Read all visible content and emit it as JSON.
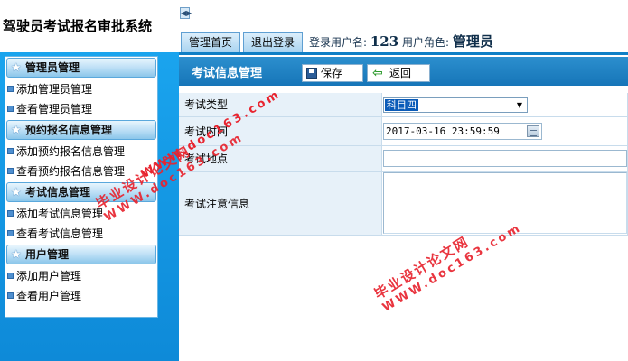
{
  "app": {
    "title": "驾驶员考试报名审批系统"
  },
  "topbar": {
    "home_label": "管理首页",
    "logout_label": "退出登录",
    "login_user_label": "登录用户名:",
    "login_user_value": "123",
    "role_label": "用户角色:",
    "role_value": "管理员"
  },
  "sidebar": {
    "groups": [
      {
        "title": "管理员管理",
        "items": [
          {
            "label": "添加管理员管理"
          },
          {
            "label": "查看管理员管理"
          }
        ]
      },
      {
        "title": "预约报名信息管理",
        "items": [
          {
            "label": "添加预约报名信息管理"
          },
          {
            "label": "查看预约报名信息管理"
          }
        ]
      },
      {
        "title": "考试信息管理",
        "items": [
          {
            "label": "添加考试信息管理"
          },
          {
            "label": "查看考试信息管理"
          }
        ]
      },
      {
        "title": "用户管理",
        "items": [
          {
            "label": "添加用户管理"
          },
          {
            "label": "查看用户管理"
          }
        ]
      }
    ]
  },
  "content": {
    "section_title": "考试信息管理",
    "save_label": "保存",
    "return_label": "返回",
    "form": {
      "rows": [
        {
          "label": "考试类型",
          "value": "科目四"
        },
        {
          "label": "考试时间",
          "value": "2017-03-16 23:59:59"
        },
        {
          "label": "考试地点",
          "value": ""
        },
        {
          "label": "考试注意信息",
          "value": ""
        }
      ]
    }
  },
  "watermark": {
    "cn_text": "毕业设计论文网",
    "url_text": "WWW.doc163.com"
  },
  "colors": {
    "sidebar_bg": "#1aa4ee",
    "header_blue": "#1675b8",
    "label_bg": "#e7f1f9",
    "watermark": "#e8242f"
  }
}
